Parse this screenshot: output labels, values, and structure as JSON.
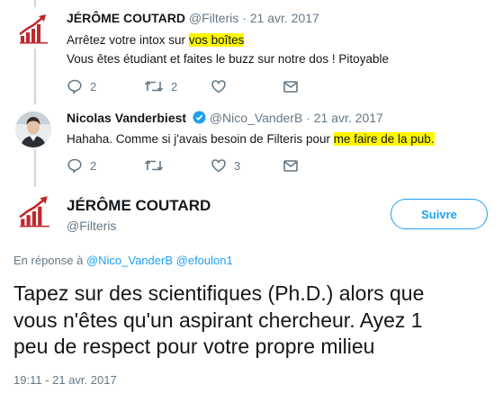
{
  "tweets": [
    {
      "name": "JÉRÔME COUTARD",
      "handle": "@Filteris",
      "date": "21 avr. 2017",
      "line1_pre": "Arrêtez votre intox sur ",
      "line1_hl": "vos boîtes",
      "line2": "Vous êtes étudiant et faites le buzz sur notre dos ! Pitoyable",
      "replies": "2",
      "retweets": "2",
      "likes": ""
    },
    {
      "name": "Nicolas Vanderbiest",
      "verified": true,
      "handle": "@Nico_VanderB",
      "date": "21 avr. 2017",
      "line1_pre": "Hahaha. Comme si j'avais besoin de Filteris pour ",
      "line1_hl": "me faire de la pub.",
      "replies": "2",
      "retweets": "",
      "likes": "3"
    }
  ],
  "main_tweet": {
    "name": "JÉRÔME COUTARD",
    "handle": "@Filteris",
    "follow_label": "Suivre",
    "reply_prefix": "En réponse à ",
    "mention1": "@Nico_VanderB",
    "mention2": "@efoulon1",
    "text_lines": [
      "Tapez sur des scientifiques (Ph.D.) alors que",
      "vous n'êtes qu'un aspirant chercheur. Ayez 1",
      "peu de respect pour votre propre milieu"
    ],
    "timestamp": "19:11 - 21 avr. 2017"
  },
  "colors": {
    "highlight": "#fff700",
    "link": "#1da1f2",
    "muted": "#657786",
    "logo_red": "#c1272d"
  },
  "icons": [
    "reply-icon",
    "retweet-icon",
    "like-icon",
    "message-icon",
    "verified-icon",
    "filteris-logo"
  ]
}
